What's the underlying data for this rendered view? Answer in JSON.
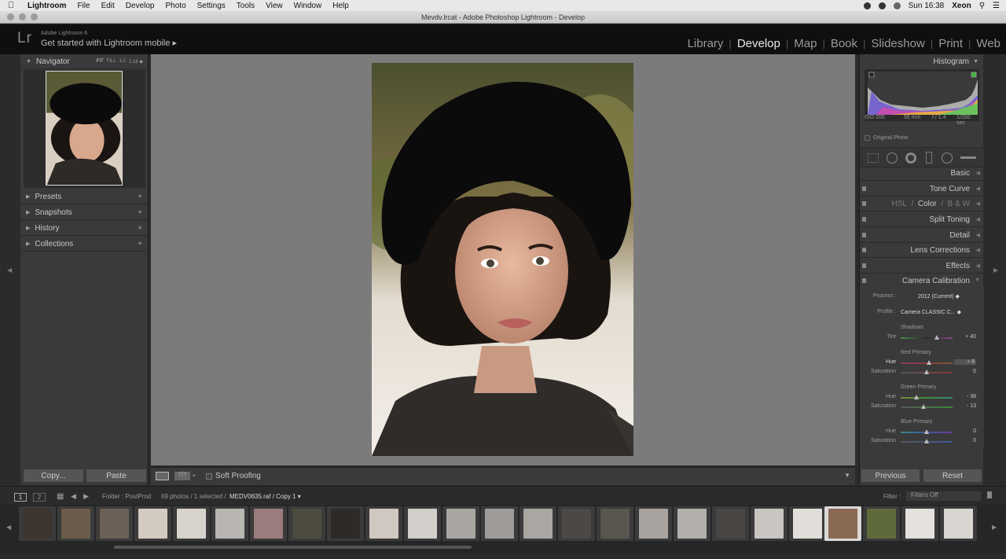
{
  "menubar": {
    "items": [
      "Lightroom",
      "File",
      "Edit",
      "Develop",
      "Photo",
      "Settings",
      "Tools",
      "View",
      "Window",
      "Help"
    ],
    "clock": "Sun 16:38",
    "user": "Xeon"
  },
  "window": {
    "title": "Mevdv.lrcat - Adobe Photoshop Lightroom - Develop"
  },
  "identity": {
    "logo": "Lr",
    "version": "Adobe Lightroom 6",
    "mobile": "Get started with Lightroom mobile ▸"
  },
  "modules": [
    "Library",
    "Develop",
    "Map",
    "Book",
    "Slideshow",
    "Print",
    "Web"
  ],
  "left_panel": {
    "navigator": {
      "title": "Navigator",
      "zoom": [
        "FIT",
        "FILL",
        "1:1",
        "1:16 ◆"
      ]
    },
    "sections": [
      {
        "label": "Presets",
        "action": "+"
      },
      {
        "label": "Snapshots",
        "action": "+"
      },
      {
        "label": "History",
        "action": "×"
      },
      {
        "label": "Collections",
        "action": "+"
      }
    ],
    "copy": "Copy...",
    "paste": "Paste"
  },
  "toolbar": {
    "soft_proofing": "Soft Proofing"
  },
  "right_panel": {
    "histogram": {
      "title": "Histogram",
      "iso": "ISO 200",
      "focal": "56 mm",
      "aperture": "f / 1.4",
      "shutter": "1/250 sec",
      "original": "Original Photo"
    },
    "sections": [
      {
        "label": "Basic"
      },
      {
        "label": "Tone Curve"
      },
      {
        "label": "HSL / Color / B & W"
      },
      {
        "label": "Split Toning"
      },
      {
        "label": "Detail"
      },
      {
        "label": "Lens Corrections"
      },
      {
        "label": "Effects"
      },
      {
        "label": "Camera Calibration"
      }
    ],
    "hsl": {
      "hsl": "HSL",
      "sep": "/",
      "color": "Color",
      "bw": "B & W"
    },
    "calibration": {
      "process_label": "Process :",
      "process_value": "2012 (Current) ◆",
      "profile_label": "Profile :",
      "profile_value": "Camera CLASSIC C... ◆",
      "shadows": {
        "title": "Shadows",
        "tint_label": "Tint",
        "tint": "+ 40",
        "tint_frac": 0.7
      },
      "red": {
        "title": "Red Primary",
        "hue_label": "Hue",
        "hue": "+ 8",
        "hue_frac": 0.54,
        "sat_label": "Saturation",
        "sat": "0",
        "sat_frac": 0.5
      },
      "green": {
        "title": "Green Primary",
        "hue_label": "Hue",
        "hue": "- 38",
        "hue_frac": 0.31,
        "sat_label": "Saturation",
        "sat": "- 13",
        "sat_frac": 0.44
      },
      "blue": {
        "title": "Blue Primary",
        "hue_label": "Hue",
        "hue": "0",
        "hue_frac": 0.5,
        "sat_label": "Saturation",
        "sat": "0",
        "sat_frac": 0.5
      }
    },
    "previous": "Previous",
    "reset": "Reset"
  },
  "filmbar": {
    "pages": [
      "1",
      "2"
    ],
    "folder": "Folder : PostProd",
    "count": "69 photos / 1 selected /",
    "file": "MEDV0635.raf / Copy 1 ▾",
    "filter_label": "Filter :",
    "filter_value": "Filters Off"
  }
}
